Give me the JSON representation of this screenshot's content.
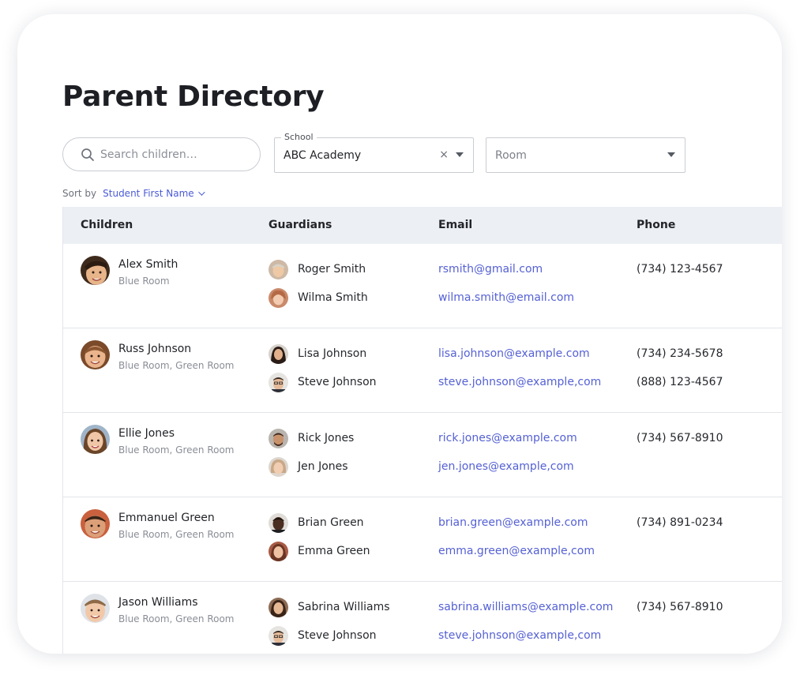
{
  "page": {
    "title": "Parent Directory"
  },
  "filters": {
    "search_placeholder": "Search children…",
    "school_label": "School",
    "school_value": "ABC Academy",
    "clear_symbol": "×",
    "room_placeholder": "Room"
  },
  "sort": {
    "label": "Sort by",
    "value": "Student First Name"
  },
  "table": {
    "headers": {
      "children": "Children",
      "guardians": "Guardians",
      "email": "Email",
      "phone": "Phone"
    },
    "rows": [
      {
        "child_name": "Alex Smith",
        "child_rooms": "Blue Room",
        "guardians": [
          {
            "name": "Roger Smith",
            "email": "rsmith@gmail.com",
            "phone": "(734) 123-4567"
          },
          {
            "name": "Wilma Smith",
            "email": "wilma.smith@email.com",
            "phone": ""
          }
        ]
      },
      {
        "child_name": "Russ Johnson",
        "child_rooms": "Blue Room, Green Room",
        "guardians": [
          {
            "name": "Lisa Johnson",
            "email": "lisa.johnson@example.com",
            "phone": "(734) 234-5678"
          },
          {
            "name": "Steve Johnson",
            "email": "steve.johnson@example,com",
            "phone": "(888) 123-4567"
          }
        ]
      },
      {
        "child_name": "Ellie Jones",
        "child_rooms": "Blue Room, Green Room",
        "guardians": [
          {
            "name": "Rick Jones",
            "email": "rick.jones@example.com",
            "phone": "(734) 567-8910"
          },
          {
            "name": "Jen Jones",
            "email": "jen.jones@example,com",
            "phone": ""
          }
        ]
      },
      {
        "child_name": "Emmanuel Green",
        "child_rooms": "Blue Room, Green Room",
        "guardians": [
          {
            "name": "Brian Green",
            "email": "brian.green@example.com",
            "phone": "(734) 891-0234"
          },
          {
            "name": "Emma Green",
            "email": "emma.green@example,com",
            "phone": ""
          }
        ]
      },
      {
        "child_name": "Jason Williams",
        "child_rooms": "Blue Room, Green Room",
        "guardians": [
          {
            "name": "Sabrina Williams",
            "email": "sabrina.williams@example.com",
            "phone": "(734) 567-8910"
          },
          {
            "name": "Steve Johnson",
            "email": "steve.johnson@example,com",
            "phone": ""
          }
        ]
      }
    ]
  },
  "colors": {
    "accent": "#4b5bd6",
    "link": "#5561d4",
    "header_bg": "#eceff4",
    "border": "#e3e5ea"
  },
  "icons": {
    "search": "search-icon",
    "clear": "clear-icon",
    "dropdown": "caret-down-icon",
    "sort": "chevron-down-icon"
  }
}
